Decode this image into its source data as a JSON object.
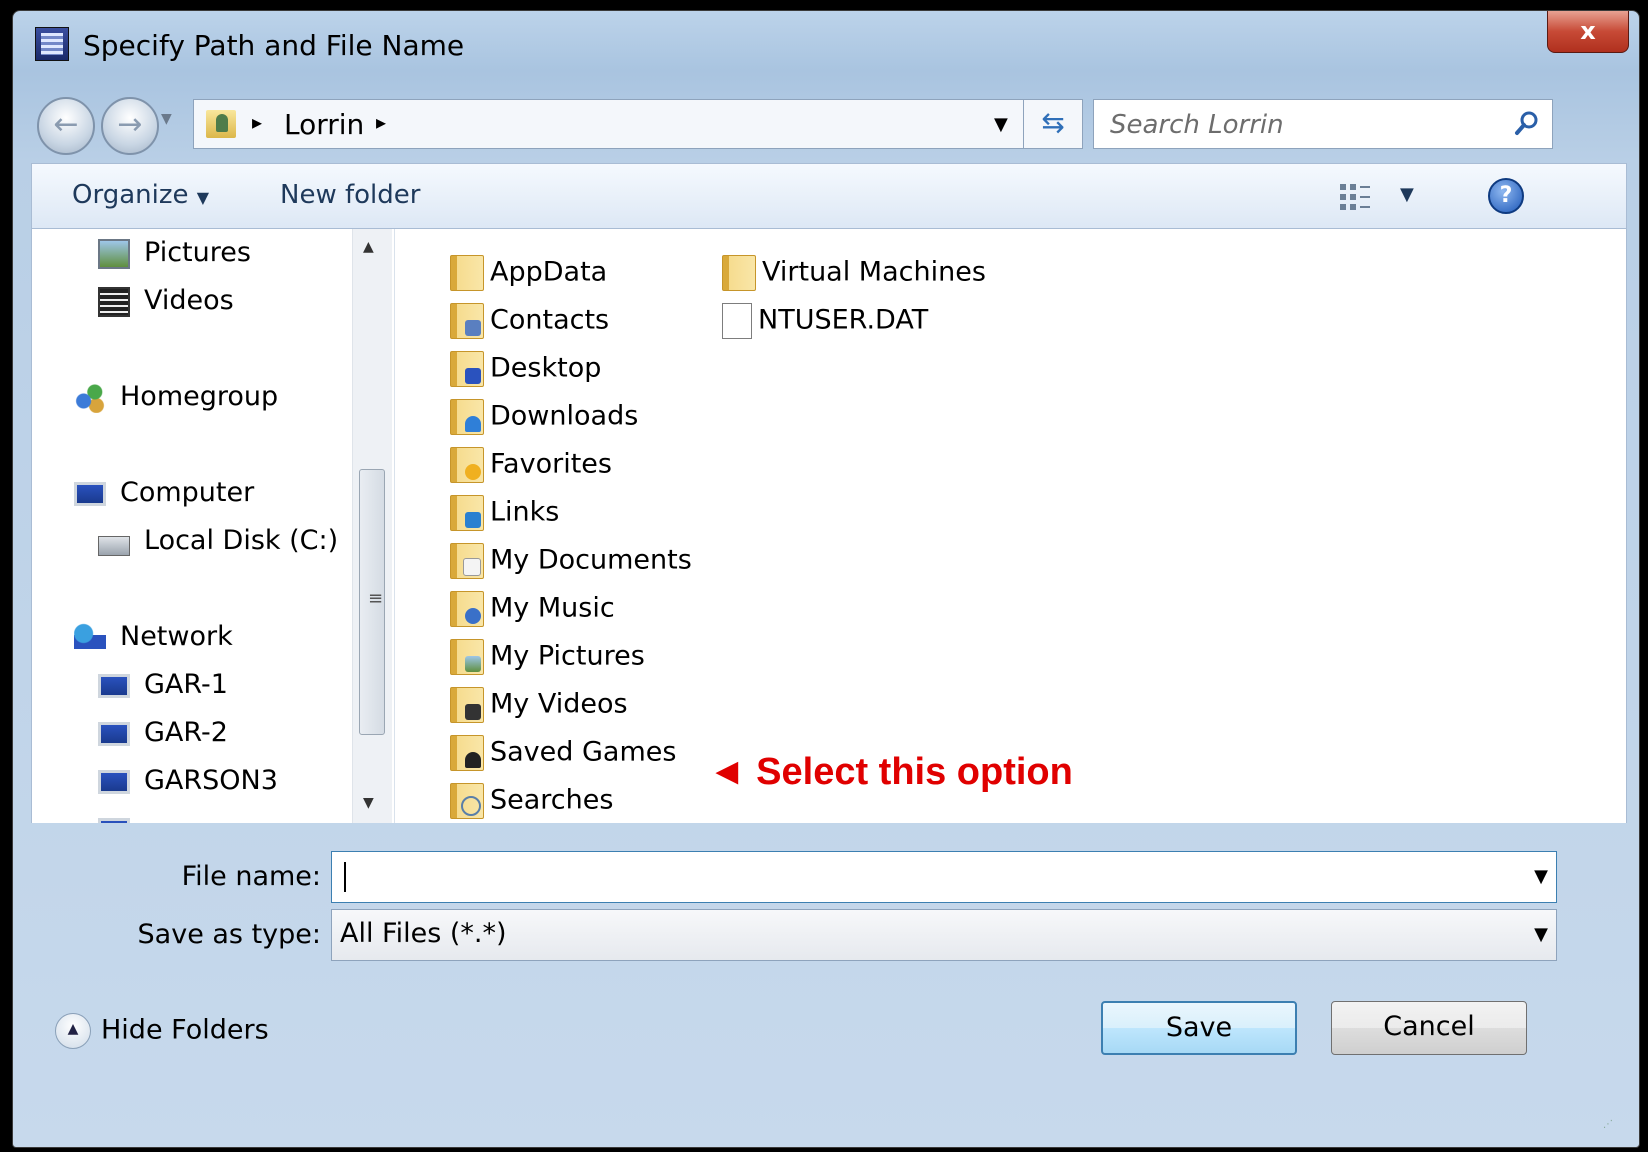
{
  "window": {
    "title": "Specify Path and File Name",
    "close_label": "x"
  },
  "address_bar": {
    "crumb": "Lorrin",
    "separator": "▸"
  },
  "search": {
    "placeholder": "Search Lorrin"
  },
  "toolbar": {
    "organize_label": "Organize",
    "new_folder_label": "New folder"
  },
  "nav_pane": {
    "items": [
      {
        "label": "Pictures",
        "icon": "pictures-icon"
      },
      {
        "label": "Videos",
        "icon": "videos-icon"
      },
      {
        "label": "Homegroup",
        "icon": "homegroup-icon"
      },
      {
        "label": "Computer",
        "icon": "computer-icon"
      },
      {
        "label": "Local Disk (C:)",
        "icon": "local-disk-icon"
      },
      {
        "label": "Network",
        "icon": "network-icon"
      },
      {
        "label": "GAR-1",
        "icon": "network-computer-icon"
      },
      {
        "label": "GAR-2",
        "icon": "network-computer-icon"
      },
      {
        "label": "GARSON3",
        "icon": "network-computer-icon"
      }
    ]
  },
  "files": {
    "items": [
      {
        "label": "AppData",
        "icon": "folder-icon"
      },
      {
        "label": "Contacts",
        "icon": "contacts-folder-icon"
      },
      {
        "label": "Desktop",
        "icon": "desktop-folder-icon"
      },
      {
        "label": "Downloads",
        "icon": "downloads-folder-icon"
      },
      {
        "label": "Favorites",
        "icon": "favorites-folder-icon"
      },
      {
        "label": "Links",
        "icon": "links-folder-icon"
      },
      {
        "label": "My Documents",
        "icon": "documents-folder-icon"
      },
      {
        "label": "My Music",
        "icon": "music-folder-icon"
      },
      {
        "label": "My Pictures",
        "icon": "pictures-folder-icon"
      },
      {
        "label": "My Videos",
        "icon": "videos-folder-icon"
      },
      {
        "label": "Saved Games",
        "icon": "saved-games-folder-icon"
      },
      {
        "label": "Searches",
        "icon": "searches-folder-icon"
      },
      {
        "label": "Virtual Machines",
        "icon": "folder-icon"
      },
      {
        "label": "NTUSER.DAT",
        "icon": "file-icon"
      }
    ]
  },
  "annotation": {
    "text": "◄ Select this option",
    "color": "#e00000"
  },
  "form": {
    "file_name_label": "File name:",
    "file_name_value": "",
    "save_type_label": "Save as type:",
    "save_type_value": "All Files (*.*)"
  },
  "footer": {
    "hide_folders_label": "Hide Folders",
    "save_label": "Save",
    "cancel_label": "Cancel"
  }
}
